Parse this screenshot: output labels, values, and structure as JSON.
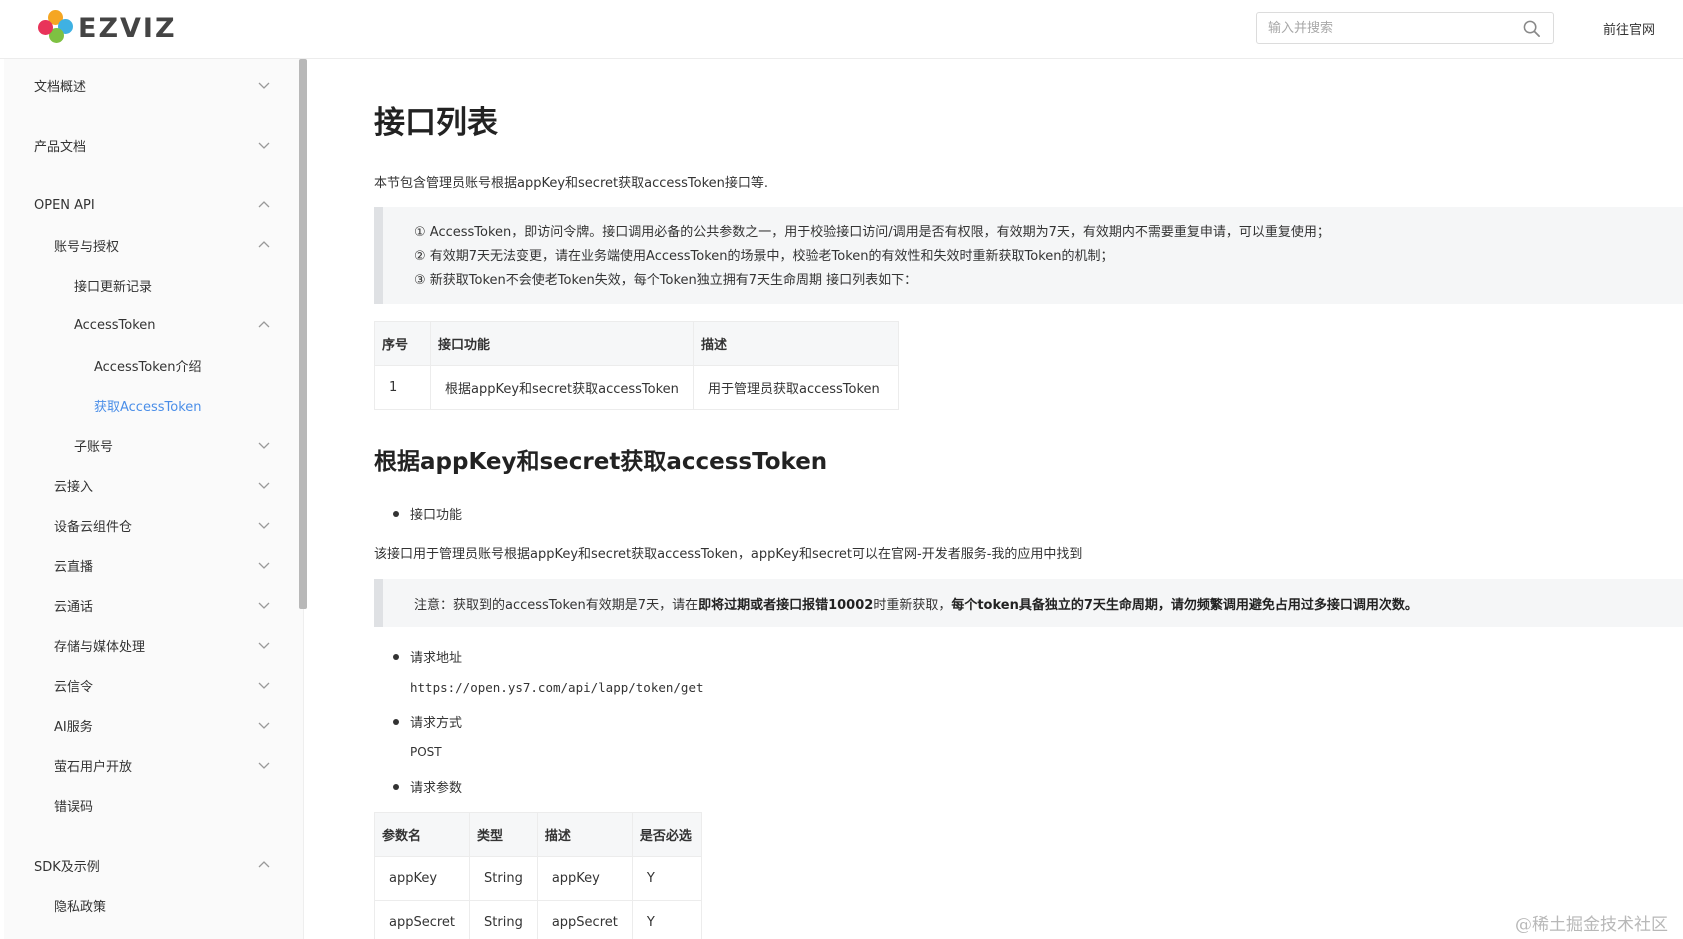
{
  "header": {
    "logo_text": "EZVIZ",
    "search_placeholder": "输入并搜索",
    "goto_site": "前往官网"
  },
  "sidebar": {
    "items": [
      {
        "label": "文档概述",
        "level": 0,
        "chevron": "down"
      },
      {
        "label": "产品文档",
        "level": 0,
        "chevron": "down"
      },
      {
        "label": "OPEN API",
        "level": 0,
        "chevron": "up"
      },
      {
        "label": "账号与授权",
        "level": 1,
        "chevron": "up"
      },
      {
        "label": "接口更新记录",
        "level": 2,
        "chevron": ""
      },
      {
        "label": "AccessToken",
        "level": 2,
        "chevron": "up"
      },
      {
        "label": "AccessToken介绍",
        "level": 3,
        "chevron": ""
      },
      {
        "label": "获取AccessToken",
        "level": 3,
        "chevron": "",
        "active": true
      },
      {
        "label": "子账号",
        "level": 2,
        "chevron": "down"
      },
      {
        "label": "云接入",
        "level": 1,
        "chevron": "down"
      },
      {
        "label": "设备云组件仓",
        "level": 1,
        "chevron": "down"
      },
      {
        "label": "云直播",
        "level": 1,
        "chevron": "down"
      },
      {
        "label": "云通话",
        "level": 1,
        "chevron": "down"
      },
      {
        "label": "存储与媒体处理",
        "level": 1,
        "chevron": "down"
      },
      {
        "label": "云信令",
        "level": 1,
        "chevron": "down"
      },
      {
        "label": "AI服务",
        "level": 1,
        "chevron": "down"
      },
      {
        "label": "萤石用户开放",
        "level": 1,
        "chevron": "down"
      },
      {
        "label": "错误码",
        "level": 1,
        "chevron": ""
      },
      {
        "label": "SDK及示例",
        "level": 0,
        "chevron": "up"
      },
      {
        "label": "隐私政策",
        "level": 1,
        "chevron": ""
      }
    ]
  },
  "main": {
    "title": "接口列表",
    "intro": "本节包含管理员账号根据appKey和secret获取accessToken接口等.",
    "notes": [
      "① AccessToken，即访问令牌。接口调用必备的公共参数之一，用于校验接口访问/调用是否有权限，有效期为7天，有效期内不需要重复申请，可以重复使用；",
      "② 有效期7天无法变更，请在业务端使用AccessToken的场景中，校验老Token的有效性和失效时重新获取Token的机制；",
      "③ 新获取Token不会使老Token失效，每个Token独立拥有7天生命周期 接口列表如下："
    ],
    "api_table": {
      "headers": [
        "序号",
        "接口功能",
        "描述"
      ],
      "rows": [
        [
          "1",
          "根据appKey和secret获取accessToken",
          "用于管理员获取accessToken"
        ]
      ]
    },
    "section_title": "根据appKey和secret获取accessToken",
    "bullet_function": "接口功能",
    "function_desc": "该接口用于管理员账号根据appKey和secret获取accessToken，appKey和secret可以在官网-开发者服务-我的应用中找到",
    "note2_prefix": "注意：获取到的accessToken有效期是7天，请在",
    "note2_b1": "即将过期或者接口报错10002",
    "note2_mid": "时重新获取，",
    "note2_b2": "每个token具备独立的7天生命周期，请勿频繁调用避免占用过多接口调用次数。",
    "bullet_url": "请求地址",
    "url": "https://open.ys7.com/api/lapp/token/get",
    "bullet_method": "请求方式",
    "method": "POST",
    "bullet_params": "请求参数",
    "param_table": {
      "headers": [
        "参数名",
        "类型",
        "描述",
        "是否必选"
      ],
      "rows": [
        [
          "appKey",
          "String",
          "appKey",
          "Y"
        ],
        [
          "appSecret",
          "String",
          "appSecret",
          "Y"
        ]
      ]
    }
  },
  "watermark": "@稀土掘金技术社区"
}
